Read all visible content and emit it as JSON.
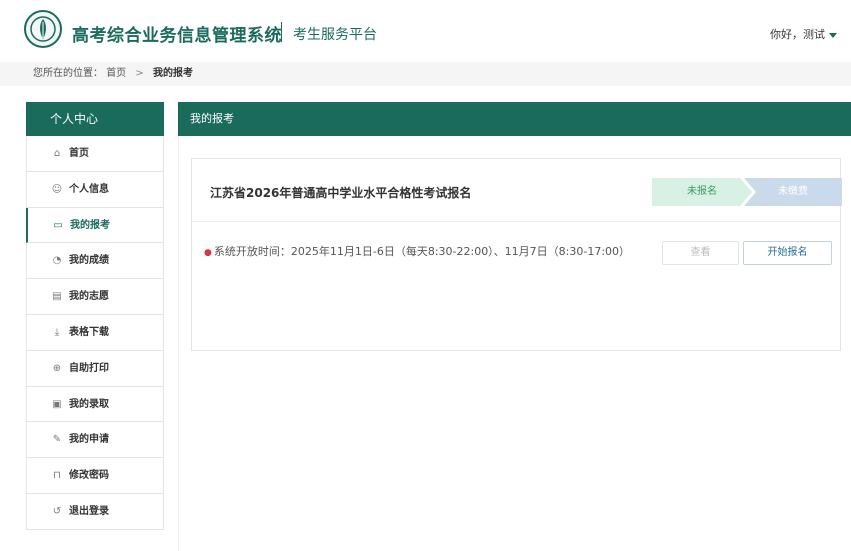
{
  "header": {
    "system_title": "高考综合业务信息管理系统",
    "platform_title": "考生服务平台",
    "user_greeting": "你好，测试"
  },
  "breadcrumb": {
    "prefix": "您所在的位置：",
    "home": "首页",
    "separator": ">",
    "current": "我的报考"
  },
  "sidebar": {
    "header": "个人中心",
    "items": [
      {
        "label": "首页",
        "icon": "home-icon",
        "glyph": "⌂"
      },
      {
        "label": "个人信息",
        "icon": "user-icon",
        "glyph": "☺"
      },
      {
        "label": "我的报考",
        "icon": "id-card-icon",
        "glyph": "▭",
        "active": true
      },
      {
        "label": "我的成绩",
        "icon": "chart-icon",
        "glyph": "◔"
      },
      {
        "label": "我的志愿",
        "icon": "form-icon",
        "glyph": "▤"
      },
      {
        "label": "表格下载",
        "icon": "download-icon",
        "glyph": "⤓"
      },
      {
        "label": "自助打印",
        "icon": "print-icon",
        "glyph": "⊕"
      },
      {
        "label": "我的录取",
        "icon": "calendar-icon",
        "glyph": "▣"
      },
      {
        "label": "我的申请",
        "icon": "edit-icon",
        "glyph": "✎"
      },
      {
        "label": "修改密码",
        "icon": "lock-icon",
        "glyph": "⊓"
      },
      {
        "label": "退出登录",
        "icon": "logout-icon",
        "glyph": "↺"
      }
    ]
  },
  "main": {
    "panel_title": "我的报考",
    "card": {
      "exam_title": "江苏省2026年普通高中学业水平合格性考试报名",
      "steps": [
        "未报名",
        "未缴费"
      ],
      "open_time": "系统开放时间：2025年11月1日-6日（每天8:30-22:00）、11月7日（8:30-17:00）",
      "view_button": "查看",
      "start_button": "开始报名"
    }
  },
  "colors": {
    "brand": "#1b6b5d",
    "step_done_bg": "#d8f1e4",
    "step_pending_bg": "#c9dbea",
    "bullet": "#d9363e"
  }
}
